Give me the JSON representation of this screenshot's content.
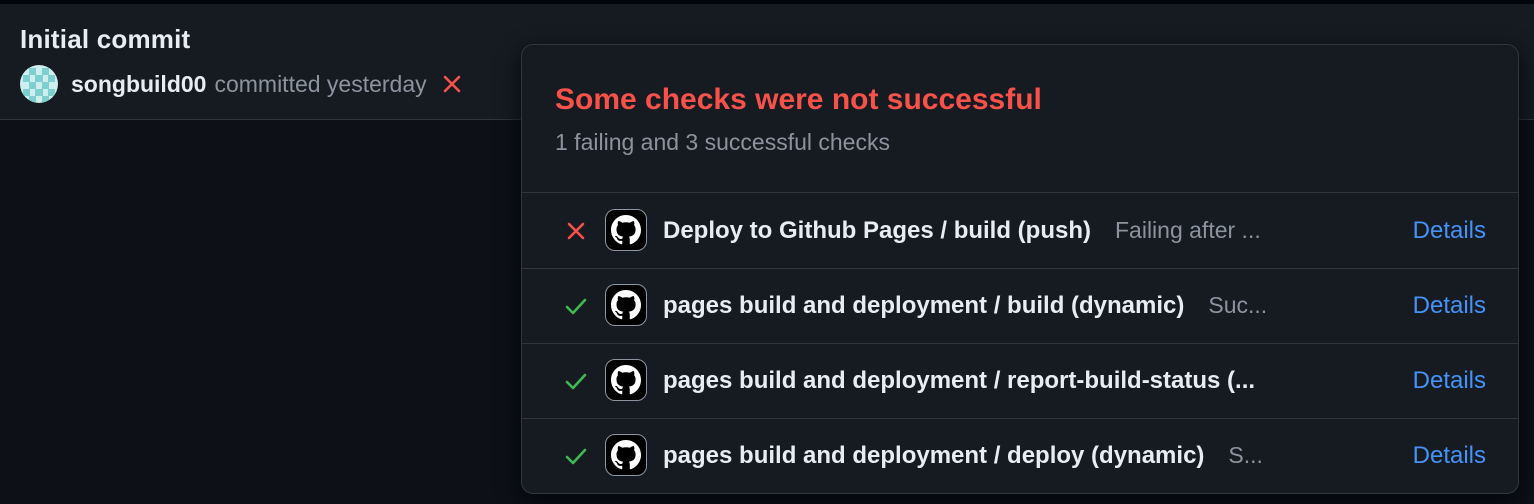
{
  "commit": {
    "title": "Initial commit",
    "author": "songbuild00",
    "committed_text": "committed yesterday",
    "status_icon": "x-icon",
    "status_color": "#f85149"
  },
  "checks_popover": {
    "title": "Some checks were not successful",
    "subtitle": "1 failing and 3 successful checks",
    "title_color": "#f85149",
    "checks": [
      {
        "status": "failure",
        "icon": "github-icon",
        "name": "Deploy to Github Pages / build (push)",
        "description": "Failing after ...",
        "details_label": "Details"
      },
      {
        "status": "success",
        "icon": "github-icon",
        "name": "pages build and deployment / build (dynamic)",
        "description": "Suc...",
        "details_label": "Details"
      },
      {
        "status": "success",
        "icon": "github-icon",
        "name": "pages build and deployment / report-build-status (...",
        "description": "",
        "details_label": "Details"
      },
      {
        "status": "success",
        "icon": "github-icon",
        "name": "pages build and deployment / deploy (dynamic)",
        "description": "S...",
        "details_label": "Details"
      }
    ]
  },
  "colors": {
    "failure": "#f85149",
    "success": "#3fb950",
    "link": "#4493f8",
    "muted": "#8b949e"
  }
}
